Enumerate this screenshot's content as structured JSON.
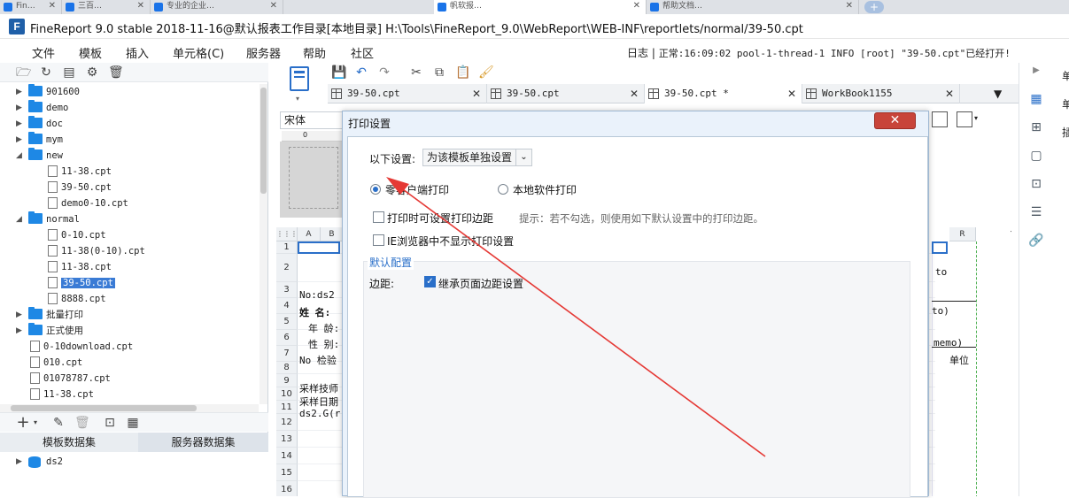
{
  "browser": {
    "tabs": [
      "Fin…",
      "三百…",
      "专业的企业…",
      "帆软报…",
      "…",
      "帮助文档…"
    ]
  },
  "window": {
    "logo": "F",
    "title": "FineReport 9.0 stable 2018-11-16@默认报表工作目录[本地目录]    H:\\Tools\\FineReport_9.0\\WebReport\\WEB-INF\\reportlets/normal/39-50.cpt"
  },
  "menu": {
    "items": [
      "文件",
      "模板",
      "插入",
      "单元格(C)",
      "服务器",
      "帮助",
      "社区"
    ],
    "log_label": "日志",
    "log_message": "正常:16:09:02 pool-1-thread-1 INFO [root] \"39-50.cpt\"已经打开!"
  },
  "tree": {
    "items": [
      {
        "label": "901600",
        "type": "folder",
        "level": 0,
        "expanded": false
      },
      {
        "label": "demo",
        "type": "folder",
        "level": 0,
        "expanded": false
      },
      {
        "label": "doc",
        "type": "folder",
        "level": 0,
        "expanded": false
      },
      {
        "label": "mym",
        "type": "folder",
        "level": 0,
        "expanded": false
      },
      {
        "label": "new",
        "type": "folder",
        "level": 0,
        "expanded": true
      },
      {
        "label": "11-38.cpt",
        "type": "file",
        "level": 1
      },
      {
        "label": "39-50.cpt",
        "type": "file",
        "level": 1
      },
      {
        "label": "demo0-10.cpt",
        "type": "file",
        "level": 1
      },
      {
        "label": "normal",
        "type": "folder",
        "level": 0,
        "expanded": true
      },
      {
        "label": "0-10.cpt",
        "type": "file",
        "level": 1
      },
      {
        "label": "11-38(0-10).cpt",
        "type": "file",
        "level": 1
      },
      {
        "label": "11-38.cpt",
        "type": "file",
        "level": 1
      },
      {
        "label": "39-50.cpt",
        "type": "file",
        "level": 1,
        "selected": true
      },
      {
        "label": "8888.cpt",
        "type": "file",
        "level": 1
      },
      {
        "label": "批量打印",
        "type": "folder",
        "level": 0,
        "expanded": false
      },
      {
        "label": "正式使用",
        "type": "folder",
        "level": 0,
        "expanded": false
      },
      {
        "label": "0-10download.cpt",
        "type": "file",
        "level": 0
      },
      {
        "label": "010.cpt",
        "type": "file",
        "level": 0
      },
      {
        "label": "01078787.cpt",
        "type": "file",
        "level": 0
      },
      {
        "label": "11-38.cpt",
        "type": "file",
        "level": 0
      }
    ]
  },
  "datasets": {
    "tabs": [
      "模板数据集",
      "服务器数据集"
    ],
    "items": [
      "ds2"
    ]
  },
  "file_tabs": [
    {
      "label": "39-50.cpt"
    },
    {
      "label": "39-50.cpt"
    },
    {
      "label": "39-50.cpt *",
      "active": true
    },
    {
      "label": "WorkBook1155"
    }
  ],
  "editor": {
    "font": "宋体",
    "columns": [
      "A",
      "B"
    ],
    "far_column": "R",
    "rows": [
      "1",
      "2",
      "3",
      "4",
      "5",
      "6",
      "7",
      "8",
      "9",
      "10",
      "11",
      "12",
      "13",
      "14",
      "15",
      "16"
    ],
    "cells": {
      "r3": "No:ds2",
      "r4": "姓 名:",
      "r5": "年 龄:",
      "r6": "性 别:",
      "r7": "No  检验",
      "r9": "采样技师",
      "r10": "采样日期",
      "r11": "ds2.G(r",
      "right_r2": "to",
      "right_r4": "to)",
      "right_r6": "memo)",
      "right_r7": "单位"
    }
  },
  "right_panel": {
    "labels": [
      "单",
      "单",
      "插"
    ]
  },
  "dialog": {
    "title": "打印设置",
    "close": "✕",
    "setting_label": "以下设置:",
    "setting_value": "为该模板单独设置",
    "radio_zero_client": "零客户端打印",
    "radio_local": "本地软件打印",
    "check_margin": "打印时可设置打印边距",
    "hint": "提示：若不勾选，则使用如下默认设置中的打印边距。",
    "check_ie": "IE浏览器中不显示打印设置",
    "section_title": "默认配置",
    "margin_label": "边距:",
    "inherit_margin": "继承页面边距设置",
    "zero_client_selected": true,
    "inherit_checked": true
  },
  "colors": {
    "accent": "#2a6fc9",
    "close_button": "#c8443a",
    "annotation_arrow": "#e53935",
    "folder": "#1e88e5"
  }
}
